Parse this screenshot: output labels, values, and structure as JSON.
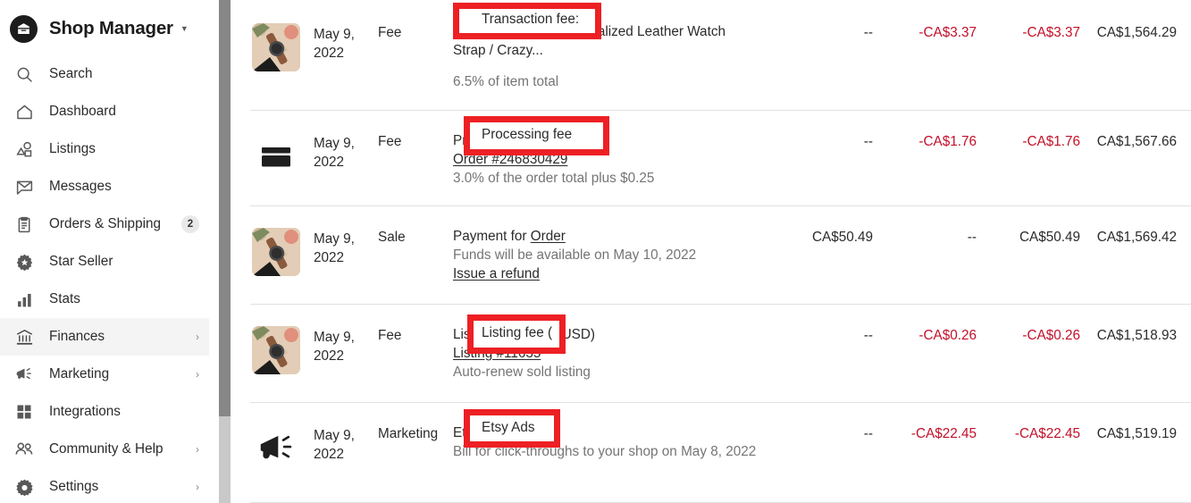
{
  "sidebar": {
    "brand": {
      "title": "Shop Manager",
      "caret": "▼",
      "logo_icon": "etsy-shop-logo-icon"
    },
    "items": [
      {
        "label": "Search",
        "icon": "search-icon",
        "badge": null,
        "chevron": false,
        "active": false
      },
      {
        "label": "Dashboard",
        "icon": "home-icon",
        "badge": null,
        "chevron": false,
        "active": false
      },
      {
        "label": "Listings",
        "icon": "listings-icon",
        "badge": null,
        "chevron": false,
        "active": false
      },
      {
        "label": "Messages",
        "icon": "envelope-icon",
        "badge": null,
        "chevron": false,
        "active": false
      },
      {
        "label": "Orders & Shipping",
        "icon": "clipboard-icon",
        "badge": "2",
        "chevron": false,
        "active": false
      },
      {
        "label": "Star Seller",
        "icon": "star-badge-icon",
        "badge": null,
        "chevron": false,
        "active": false
      },
      {
        "label": "Stats",
        "icon": "bar-chart-icon",
        "badge": null,
        "chevron": false,
        "active": false
      },
      {
        "label": "Finances",
        "icon": "bank-icon",
        "badge": null,
        "chevron": true,
        "active": true
      },
      {
        "label": "Marketing",
        "icon": "megaphone-icon",
        "badge": null,
        "chevron": true,
        "active": false
      },
      {
        "label": "Integrations",
        "icon": "grid-icon",
        "badge": null,
        "chevron": false,
        "active": false
      },
      {
        "label": "Community & Help",
        "icon": "people-icon",
        "badge": null,
        "chevron": true,
        "active": false
      },
      {
        "label": "Settings",
        "icon": "gear-icon",
        "badge": null,
        "chevron": true,
        "active": false
      }
    ],
    "chevron_glyph": "›"
  },
  "scrollbar": {
    "orientation": "vertical",
    "thumb_position": "top"
  },
  "colors": {
    "accent_red": "#ed2024",
    "negative_amount": "#c3102a",
    "text": "#2b2b2b",
    "muted_text": "#757575",
    "active_row_bg": "#f4f4f4",
    "divider": "#e1e1e1"
  },
  "transactions": [
    {
      "thumbnail": "watch-product-photo",
      "date": "May 9,\n2022",
      "date_line1": "May 9,",
      "date_line2": "2022",
      "type": "Fee",
      "title": "Transaction fee: Personalized Leather Watch Strap / Crazy...",
      "title_highlight": "Transaction fee:",
      "title_rest": "Personalized Leather Watch",
      "title_line2": "Strap / Crazy...",
      "subtitle": "6.5% of item total",
      "link": null,
      "net": "--",
      "fees": "-CA$3.37",
      "total": "-CA$3.37",
      "balance": "CA$1,564.29",
      "fees_negative": true,
      "total_negative": true,
      "highlighted": true
    },
    {
      "thumbnail": "credit-card-icon",
      "date_line1": "May 9,",
      "date_line2": "2022",
      "type": "Fee",
      "title": "Processing fee",
      "title_highlight": "Processing fee",
      "link": "Order #246830429",
      "subtitle": "3.0% of the order total plus $0.25",
      "net": "--",
      "fees": "-CA$1.76",
      "total": "-CA$1.76",
      "balance": "CA$1,567.66",
      "fees_negative": true,
      "total_negative": true,
      "highlighted": true
    },
    {
      "thumbnail": "watch-product-photo",
      "date_line1": "May 9,",
      "date_line2": "2022",
      "type": "Sale",
      "title_prefix": "Payment for ",
      "title_link": "Order",
      "subtitle": "Funds will be available on May 10, 2022",
      "action_link": "Issue a refund",
      "net": "CA$50.49",
      "fees": "--",
      "total": "CA$50.49",
      "balance": "CA$1,569.42",
      "fees_negative": false,
      "total_negative": false,
      "highlighted": false
    },
    {
      "thumbnail": "watch-product-photo",
      "date_line1": "May 9,",
      "date_line2": "2022",
      "type": "Fee",
      "title": "Listing fee ($0.20 USD)",
      "title_highlight": "Listing fee (",
      "title_rest": "$0.20 USD)",
      "link": "Listing #11635",
      "subtitle": "Auto-renew sold listing",
      "net": "--",
      "fees": "-CA$0.26",
      "total": "-CA$0.26",
      "balance": "CA$1,518.93",
      "fees_negative": true,
      "total_negative": true,
      "highlighted": true
    },
    {
      "thumbnail": "megaphone-icon",
      "date_line1": "May 9,",
      "date_line2": "2022",
      "type": "Marketing",
      "title": "Etsy Ads",
      "title_highlight": "Etsy Ads",
      "subtitle": "Bill for click-throughs to your shop on May 8, 2022",
      "net": "--",
      "fees": "-CA$22.45",
      "total": "-CA$22.45",
      "balance": "CA$1,519.19",
      "fees_negative": true,
      "total_negative": true,
      "highlighted": true
    }
  ]
}
